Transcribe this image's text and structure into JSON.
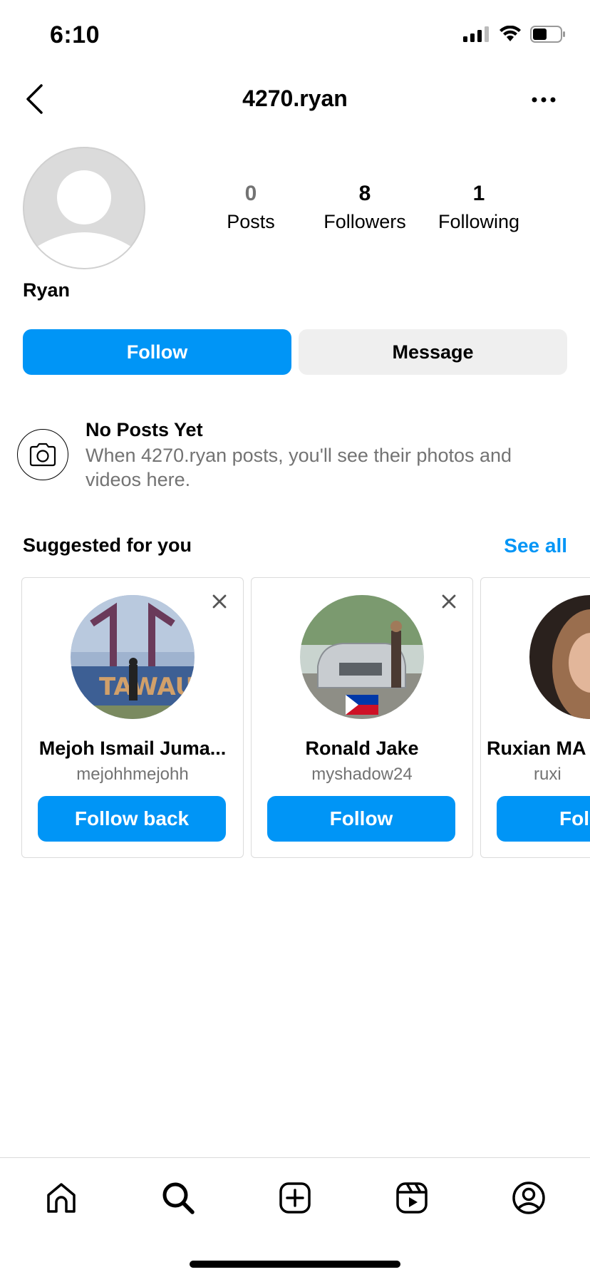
{
  "status_bar": {
    "time": "6:10"
  },
  "header": {
    "title": "4270.ryan"
  },
  "profile": {
    "name": "Ryan",
    "stats": [
      {
        "value": "0",
        "label": "Posts"
      },
      {
        "value": "8",
        "label": "Followers"
      },
      {
        "value": "1",
        "label": "Following"
      }
    ],
    "follow_label": "Follow",
    "message_label": "Message"
  },
  "no_posts": {
    "title": "No Posts Yet",
    "text": "When 4270.ryan posts, you'll see their photos and videos here."
  },
  "suggested": {
    "title": "Suggested for you",
    "see_all": "See all",
    "cards": [
      {
        "name": "Mejoh Ismail Juma...",
        "handle": "mejohhmejohh",
        "button": "Follow back"
      },
      {
        "name": "Ronald Jake",
        "handle": "myshadow24",
        "button": "Follow"
      },
      {
        "name": "Ruxian MA",
        "handle": "ruxi",
        "button": "Fol"
      }
    ]
  },
  "bottom_nav": {
    "items": [
      "home-icon",
      "search-icon",
      "create-icon",
      "reels-icon",
      "profile-icon"
    ]
  },
  "colors": {
    "accent": "#0095f6",
    "secondary_button": "#efefef",
    "muted_text": "#737373",
    "border": "#dbdbdb"
  }
}
